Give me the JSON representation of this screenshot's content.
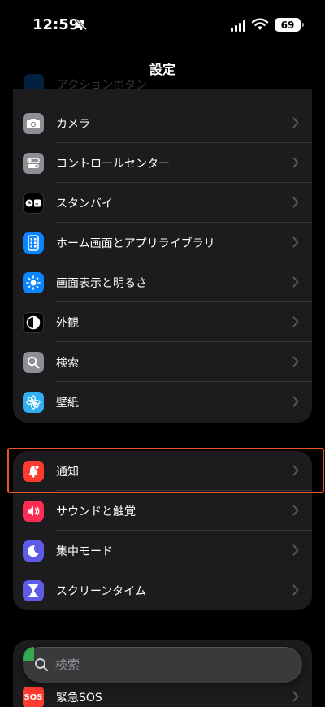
{
  "status_bar": {
    "time": "12:59",
    "battery": "69"
  },
  "ghost_rows": [
    "アクションボタン"
  ],
  "nav": {
    "title": "設定"
  },
  "group1": [
    {
      "id": "camera",
      "label": "カメラ",
      "icon": "camera-icon",
      "color": "#8e8e93"
    },
    {
      "id": "control-center",
      "label": "コントロールセンター",
      "icon": "toggles-icon",
      "color": "#8e8e93"
    },
    {
      "id": "standby",
      "label": "スタンバイ",
      "icon": "standby-icon",
      "color": "#1c1c1e"
    },
    {
      "id": "home-screen",
      "label": "ホーム画面とアプリライブラリ",
      "icon": "home-screen-icon",
      "color": "#0a84ff"
    },
    {
      "id": "display",
      "label": "画面表示と明るさ",
      "icon": "sun-icon",
      "color": "#0a84ff"
    },
    {
      "id": "appearance",
      "label": "外観",
      "icon": "appearance-icon",
      "color": "#1c1c1e"
    },
    {
      "id": "search",
      "label": "検索",
      "icon": "magnifier-icon",
      "color": "#8e8e93"
    },
    {
      "id": "wallpaper",
      "label": "壁紙",
      "icon": "flower-icon",
      "color": "#30b0f0"
    }
  ],
  "group2": [
    {
      "id": "notifications",
      "label": "通知",
      "icon": "notification-icon",
      "color": "#ff3b30"
    },
    {
      "id": "sounds",
      "label": "サウンドと触覚",
      "icon": "speaker-icon",
      "color": "#ff2d55"
    },
    {
      "id": "focus",
      "label": "集中モード",
      "icon": "moon-icon",
      "color": "#5e5ce6"
    },
    {
      "id": "screen-time",
      "label": "スクリーンタイム",
      "icon": "hourglass-icon",
      "color": "#5e5ce6"
    }
  ],
  "group3": [
    {
      "id": "emergency-sos",
      "label": "緊急SOS",
      "icon": "sos-icon",
      "icon_text": "SOS",
      "color": "#ff3b30"
    }
  ],
  "search_bar": {
    "placeholder": "検索"
  }
}
